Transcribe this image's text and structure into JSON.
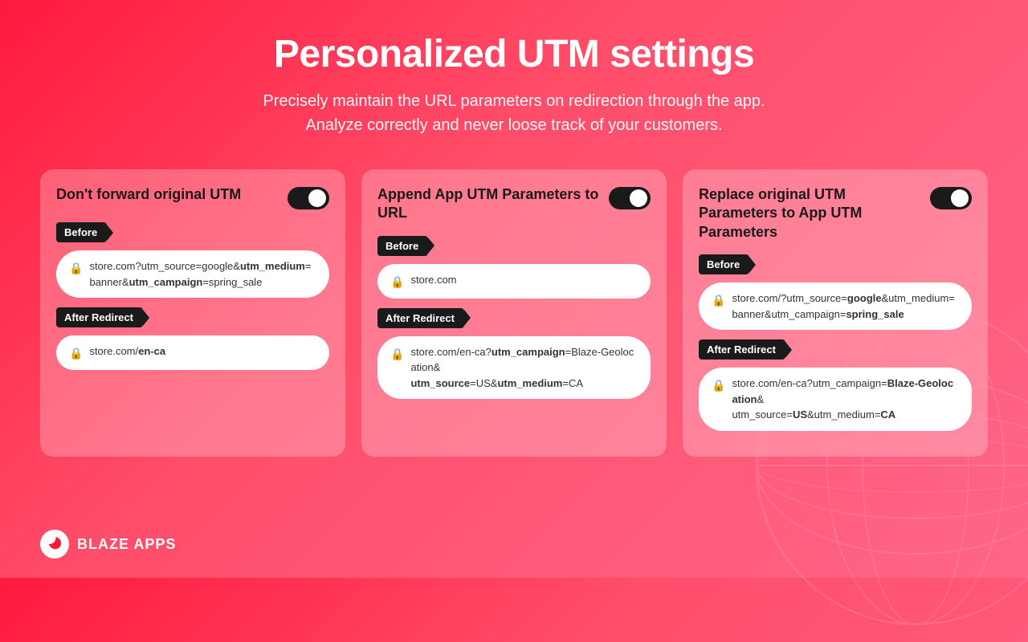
{
  "header": {
    "title": "Personalized UTM settings",
    "subtitle_line1": "Precisely maintain the URL parameters on redirection through the app.",
    "subtitle_line2": "Analyze correctly and never loose track of your customers."
  },
  "cards": [
    {
      "id": "card-1",
      "title": "Don't forward original UTM",
      "toggle_on": true,
      "before_label": "Before",
      "before_url": "store.com?utm_source=google&utm_medium=banner&utm_campaign=spring_sale",
      "before_url_plain": "store.com?",
      "before_url_parts": [
        {
          "text": "store.com?utm_source=google&",
          "bold": false
        },
        {
          "text": "utm_medium",
          "bold": true
        },
        {
          "text": "=banner&",
          "bold": false
        },
        {
          "text": "utm_campaign",
          "bold": true
        },
        {
          "text": "=spring_sale",
          "bold": false
        }
      ],
      "after_label": "After Redirect",
      "after_url": "store.com/en-ca",
      "after_url_parts": [
        {
          "text": "store.com/",
          "bold": false
        },
        {
          "text": "en-ca",
          "bold": true
        }
      ]
    },
    {
      "id": "card-2",
      "title": "Append App UTM Parameters to URL",
      "toggle_on": true,
      "before_label": "Before",
      "before_url": "store.com",
      "before_url_parts": [
        {
          "text": "store.com",
          "bold": false
        }
      ],
      "after_label": "After Redirect",
      "after_url": "store.com/en-ca?utm_campaign=Blaze-Geolocation&utm_source=US&utm_medium=CA",
      "after_url_parts": [
        {
          "text": "store.com/en-ca?",
          "bold": false
        },
        {
          "text": "utm_campaign",
          "bold": true
        },
        {
          "text": "=Blaze-Geolocation&",
          "bold": false
        },
        {
          "text": "utm_source",
          "bold": false
        },
        {
          "text": "=US&",
          "bold": false
        },
        {
          "text": "utm_medium",
          "bold": true
        },
        {
          "text": "=CA",
          "bold": false
        }
      ]
    },
    {
      "id": "card-3",
      "title": "Replace original UTM Parameters to App UTM Parameters",
      "toggle_on": true,
      "before_label": "Before",
      "before_url": "store.com/?utm_source=google&utm_medium=banner&utm_campaign=spring_sale",
      "before_url_parts": [
        {
          "text": "store.com/?utm_source=",
          "bold": false
        },
        {
          "text": "google",
          "bold": true
        },
        {
          "text": "&utm_medium=",
          "bold": false
        },
        {
          "text": "banner",
          "bold": false
        },
        {
          "text": "&utm_campaign=",
          "bold": false
        },
        {
          "text": "spring_sale",
          "bold": true
        }
      ],
      "after_label": "After Redirect",
      "after_url": "store.com/en-ca?utm_campaign=Blaze-Geolocation&utm_source=US&utm_medium=CA",
      "after_url_parts": [
        {
          "text": "store.com/en-ca?utm_campaign=",
          "bold": false
        },
        {
          "text": "Blaze-Geolocation",
          "bold": true
        },
        {
          "text": "&utm_source=",
          "bold": false
        },
        {
          "text": "US",
          "bold": false
        },
        {
          "text": "&utm_medium=",
          "bold": false
        },
        {
          "text": "CA",
          "bold": true
        }
      ]
    }
  ],
  "logo": {
    "text": "BLAZE APPS"
  }
}
